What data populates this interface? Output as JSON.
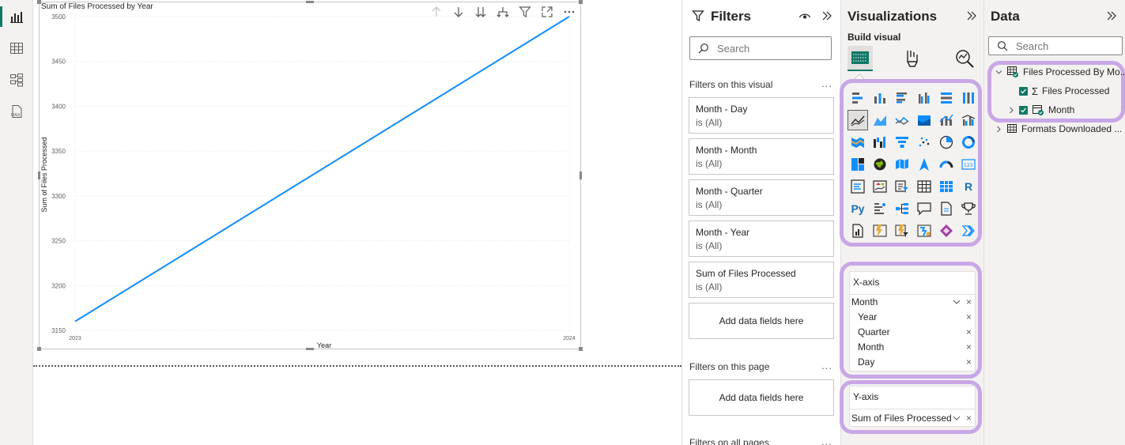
{
  "chart_data": {
    "type": "line",
    "title": "Sum of Files Processed by Year",
    "xlabel": "Year",
    "ylabel": "Sum of Files Processed",
    "x": [
      "2023",
      "2024"
    ],
    "series": [
      {
        "name": "",
        "values": [
          3160,
          3500
        ]
      }
    ],
    "ylim": [
      3150,
      3500
    ],
    "yticks": [
      3150,
      3200,
      3250,
      3300,
      3350,
      3400,
      3450,
      3500
    ],
    "grid": true,
    "line_color": "#118dff"
  },
  "filters": {
    "title": "Filters",
    "search_placeholder": "Search",
    "visual_section": "Filters on this visual",
    "page_section": "Filters on this page",
    "all_section": "Filters on all pages",
    "more": "...",
    "cards": [
      {
        "name": "Month - Day",
        "state": "is (All)"
      },
      {
        "name": "Month - Month",
        "state": "is (All)"
      },
      {
        "name": "Month - Quarter",
        "state": "is (All)"
      },
      {
        "name": "Month - Year",
        "state": "is (All)"
      },
      {
        "name": "Sum of Files Processed",
        "state": "is (All)"
      }
    ],
    "add_fields": "Add data fields here"
  },
  "visualizations": {
    "title": "Visualizations",
    "build_visual": "Build visual",
    "xaxis_label": "X-axis",
    "xaxis_field": "Month",
    "xaxis_children": [
      "Year",
      "Quarter",
      "Month",
      "Day"
    ],
    "yaxis_label": "Y-axis",
    "yaxis_field": "Sum of Files Processed",
    "remove": "×",
    "r_label": "R",
    "py_label": "Py",
    "highlight_color": "#c9a7e6"
  },
  "data_pane": {
    "title": "Data",
    "search_placeholder": "Search",
    "table1": "Files Processed By Mo...",
    "field1": "Files Processed",
    "field2": "Month",
    "table2": "Formats Downloaded ...",
    "sigma": "Σ"
  },
  "accent": "#117865"
}
